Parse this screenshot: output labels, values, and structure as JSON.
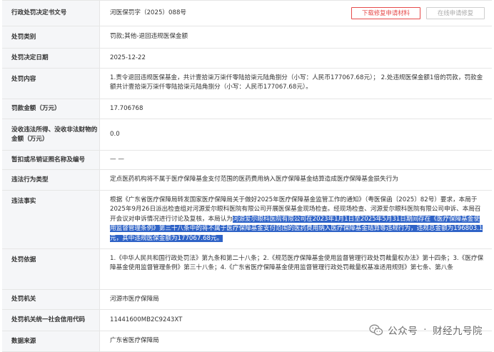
{
  "rows": [
    {
      "label": "行政处罚决定书文号",
      "value": "河医保罚字（2025）088号"
    },
    {
      "label": "处罚类别",
      "value": "罚款;其他-退回违规医保金额"
    },
    {
      "label": "处罚决定日期",
      "value": "2025-12-22"
    },
    {
      "label": "处罚内容",
      "value": "1.责令退回违规医保基金，共计壹拾柒万柒仟零陆拾柒元陆角捌分（小写：人民币177067.68元）； 2.处违规医保金额1倍的罚款，罚款金额共计壹拾柒万柒仟零陆拾柒元陆角捌分（小写：人民币177067.68元）。"
    },
    {
      "label": "罚款金额（万元）",
      "value": "17.706768"
    },
    {
      "label": "没收违法所得、没收非法财物的金额（万元）",
      "value": "0.0"
    },
    {
      "label": "暂扣或吊销证照名称及编号",
      "value": "— —"
    },
    {
      "label": "违法行为类型",
      "value": "定点医药机构将不属于医疗保障基金支付范围的医药费用纳入医疗保障基金结算造成医疗保障基金损失行为"
    },
    {
      "label": "违法事实",
      "value_plain": "根据《广东省医疗保障局转发国家医疗保障局关于做好2025年医疗保障基金监管工作的通知》（粤医保函〔2025〕82号）要求，本局于2025年9月26日派出检查组对河源爱尔眼科医院有限公司开展医保基金现场检查。经现场检查、河源爱尔眼科医院有限公司申诉、本局召开会议对申诉情况进行讨论及复核，本局认为",
      "value_highlight": "河源爱尔眼科医院有限公司在2023年1月1日至2025年5月31日期间存在《医疗保障基金使用监督管理条例》第三十八条中的将不属于医疗保障基金支付范围的医药费用纳入医疗保障基金结算等违规行为，违规总金额为196803.1元，其中违规医保金额为177067.68元。"
    },
    {
      "label": "处罚依据",
      "value": "1.《中华人民共和国行政处罚法》第九条和第二十八条；2.《规范医疗保障基金使用监督管理行政处罚裁量权办法》第十四条；3.《医疗保障基金使用监督管理条例》第三十八条；4.《广东省医疗保障基金使用监督管理行政处罚裁量权基准适用规则》第七条、第八条"
    },
    {
      "label": "处罚机关",
      "value": "河源市医疗保障局"
    },
    {
      "label": "处罚机关统一社会信用代码",
      "value": "11441600MB2C9243XT"
    },
    {
      "label": "数据来源",
      "value": "广东省医疗保障局"
    }
  ],
  "buttons": {
    "download": "下载修复申请材料",
    "online_repair": "在线申请修复"
  },
  "watermark": {
    "platform": "公众号",
    "separator": "·",
    "account": "财经九号院"
  }
}
